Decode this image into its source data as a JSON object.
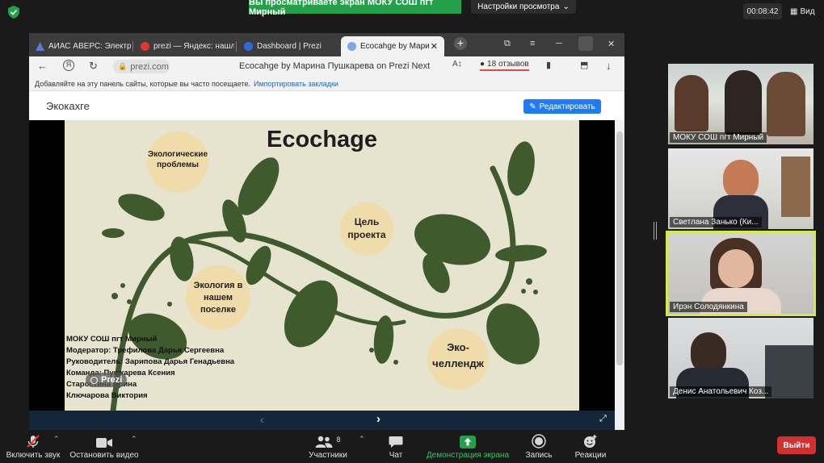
{
  "zoom": {
    "share_banner": "Вы просматриваете экран МОКУ СОШ пгт Мирный",
    "view_settings": "Настройки просмотра",
    "timer": "00:08:42",
    "view_label": "Вид",
    "leave": "Выйти"
  },
  "browser": {
    "tabs": [
      {
        "label": "АИАС АВЕРС: Электро"
      },
      {
        "label": "prezi — Яндекс: нашл"
      },
      {
        "label": "Dashboard | Prezi"
      },
      {
        "label": "Ecocahge by Мари"
      }
    ],
    "url": "prezi.com",
    "page_title": "Ecocahge by Марина Пушкарева on Prezi Next",
    "reviews": "18 отзывов",
    "bookmarks_text": "Добавляйте на эту панель сайты, которые вы часто посещаете.",
    "bookmarks_link": "Импортировать закладки"
  },
  "prezi": {
    "presentation_name": "Экокахге",
    "edit_button": "Редактировать",
    "slide": {
      "title": "Ecochage",
      "topics": [
        "Экологические проблемы",
        "Цель проекта",
        "Экология в нашем поселке",
        "Эко-челлендж"
      ],
      "credits": [
        "МОКУ СОШ пгт Мирный",
        "Модератор: Трефилова Дарья Сергеевна",
        "Руководитель: Зарипова Дарья Генадьевна",
        "Команда: Пушкарева Ксения",
        "Старостина Ирина",
        "Ключарова Виктория"
      ],
      "watermark": "Prezi"
    }
  },
  "participants": [
    {
      "name": "МОКУ СОШ пгт Мирный"
    },
    {
      "name": "Светлана Занько (Ки..."
    },
    {
      "name": "Ирэн Солодянкина"
    },
    {
      "name": "Денис Анатольевич Коз..."
    }
  ],
  "toolbar": {
    "mute": "Включить звук",
    "video": "Остановить видео",
    "participants": "Участники",
    "participants_count": "8",
    "chat": "Чат",
    "share": "Демонстрация экрана",
    "record": "Запись",
    "reactions": "Реакции"
  },
  "colors": {
    "share_green": "#23a049",
    "leave_red": "#d32f2f",
    "slide_bg": "#e6e4cf",
    "leaf_green": "#3f5a2c",
    "circle_tan": "#f0dcaa",
    "selected_outline": "#d6e94a"
  }
}
